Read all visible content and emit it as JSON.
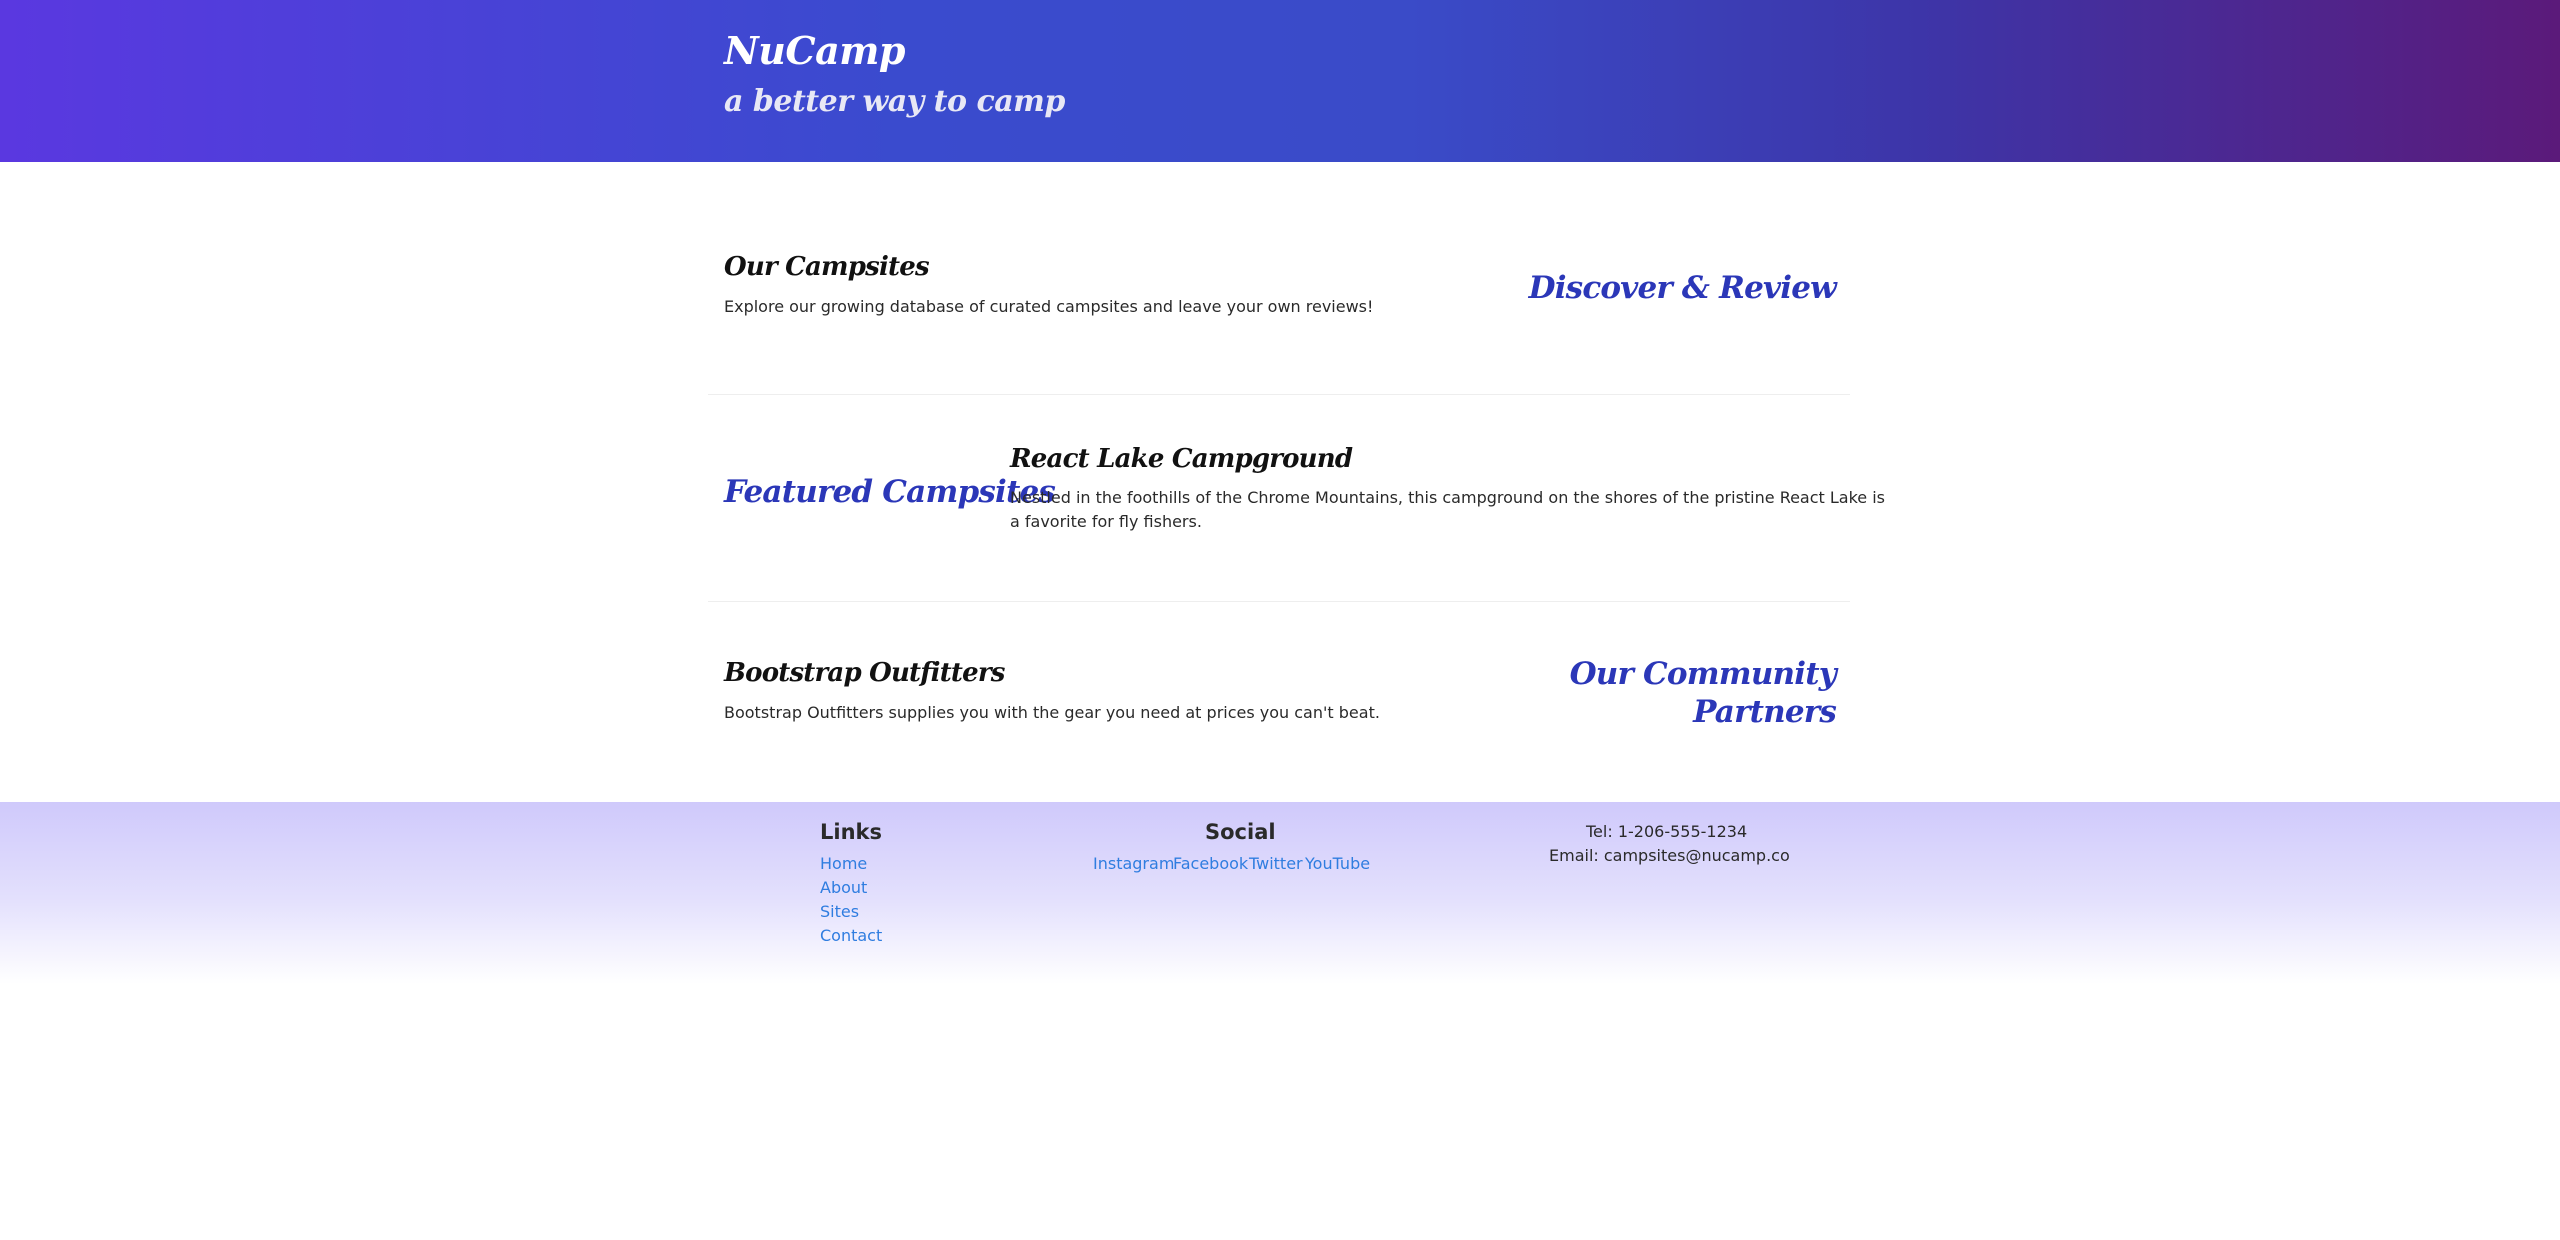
{
  "header": {
    "title": "NuCamp",
    "tagline": "a better way to camp"
  },
  "sections": {
    "campsites": {
      "title": "Our Campsites",
      "description": "Explore our growing database of curated campsites and leave your own reviews!",
      "side_label": "Discover & Review"
    },
    "featured": {
      "side_label": "Featured Campsites",
      "title": "React Lake Campground",
      "description_line1": "Nestled in the foothills of the Chrome Mountains, this campground on the shores of the pristine React Lake is",
      "description_line2": "a favorite for fly fishers."
    },
    "partners": {
      "title": "Bootstrap Outfitters",
      "description": "Bootstrap Outfitters supplies you with the gear you need at prices you can't beat.",
      "side_label_line1": "Our Community",
      "side_label_line2": "Partners"
    }
  },
  "footer": {
    "links_heading": "Links",
    "links": [
      "Home",
      "About",
      "Sites",
      "Contact"
    ],
    "social_heading": "Social",
    "social": [
      "Instagram",
      "Facebook",
      "Twitter",
      "YouTube"
    ],
    "tel": "Tel: 1-206-555-1234",
    "email": "Email: campsites@nucamp.co"
  },
  "colors": {
    "accent_blue": "#2b37b8",
    "link_blue": "#2f7de0"
  }
}
